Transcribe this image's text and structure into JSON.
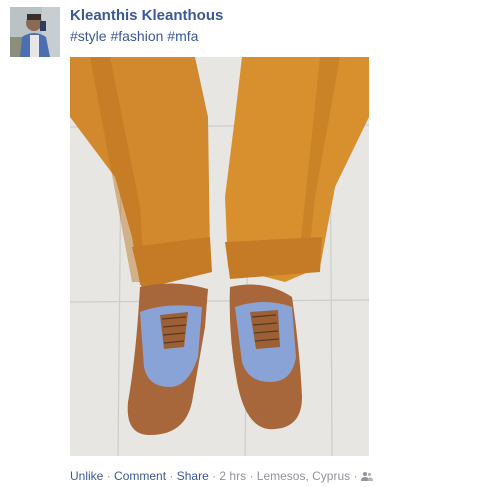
{
  "post": {
    "author_name": "Kleanthis Kleanthous",
    "hashtags": [
      "#style",
      "#fashion",
      "#mfa"
    ],
    "photo_icon": "photo-of-orange-pants-and-blue-brown-brogue-shoes",
    "avatar_icon": "profile-picture"
  },
  "actions": {
    "unlike": "Unlike",
    "comment": "Comment",
    "share": "Share",
    "separator": " · "
  },
  "meta": {
    "time": "2 hrs",
    "location": "Lemesos, Cyprus",
    "audience_icon": "friends-icon"
  },
  "colors": {
    "link": "#3b5998",
    "muted": "#90949c"
  }
}
